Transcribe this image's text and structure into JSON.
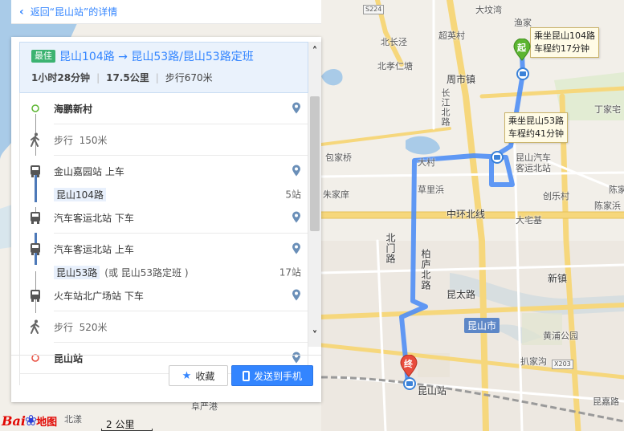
{
  "back_link": {
    "label": "返回“昆山站”的详情"
  },
  "route": {
    "best_badge": "最佳",
    "title": "昆山104路 → 昆山53路/昆山53路定班",
    "duration": "1小时28分钟",
    "distance": "17.5公里",
    "walk": "步行670米"
  },
  "steps": [
    {
      "type": "start",
      "text": "海鹏新村"
    },
    {
      "type": "walk",
      "text": "步行",
      "distance": "150米"
    },
    {
      "type": "board",
      "text": "金山嘉园站 上车"
    },
    {
      "type": "line",
      "line": "昆山104路",
      "extra": "",
      "stops": "5站"
    },
    {
      "type": "alight",
      "text": "汽车客运北站 下车"
    },
    {
      "type": "board",
      "text": "汽车客运北站 上车"
    },
    {
      "type": "line",
      "line": "昆山53路",
      "extra": "(或 昆山53路定班 )",
      "stops": "17站"
    },
    {
      "type": "alight",
      "text": "火车站北广场站 下车"
    },
    {
      "type": "walk",
      "text": "步行",
      "distance": "520米"
    },
    {
      "type": "end",
      "text": "昆山站"
    }
  ],
  "buttons": {
    "favorite": "收藏",
    "send_to_phone": "发送到手机"
  },
  "map": {
    "callout_1": [
      "乘坐昆山104路",
      "车程约17分钟"
    ],
    "callout_2": [
      "乘坐昆山53路",
      "车程约41分钟"
    ],
    "start_marker": "起",
    "end_marker": "终",
    "road_badges": [
      "S224",
      "X203"
    ],
    "district_badge": "昆山市",
    "labels": [
      "大坟湾",
      "渔家",
      "超英村",
      "北长泾",
      "北孝仁塘",
      "周市镇",
      "长江北路",
      "包家桥",
      "丁家宅",
      "昆山汽车客运北站",
      "大村",
      "草里浜",
      "创乐村",
      "陈家",
      "陈家浜",
      "朱家庠",
      "中环北线",
      "大宅基",
      "北门路",
      "柏庐北路",
      "新镇",
      "昆太路",
      "昆山",
      "黄浦公园",
      "扒家沟",
      "昆山站",
      "昆嘉路",
      "阜严港",
      "北漾"
    ]
  },
  "scale": {
    "label": "2 公里"
  },
  "logo": {
    "brand": "Bai",
    "product": "地图"
  }
}
